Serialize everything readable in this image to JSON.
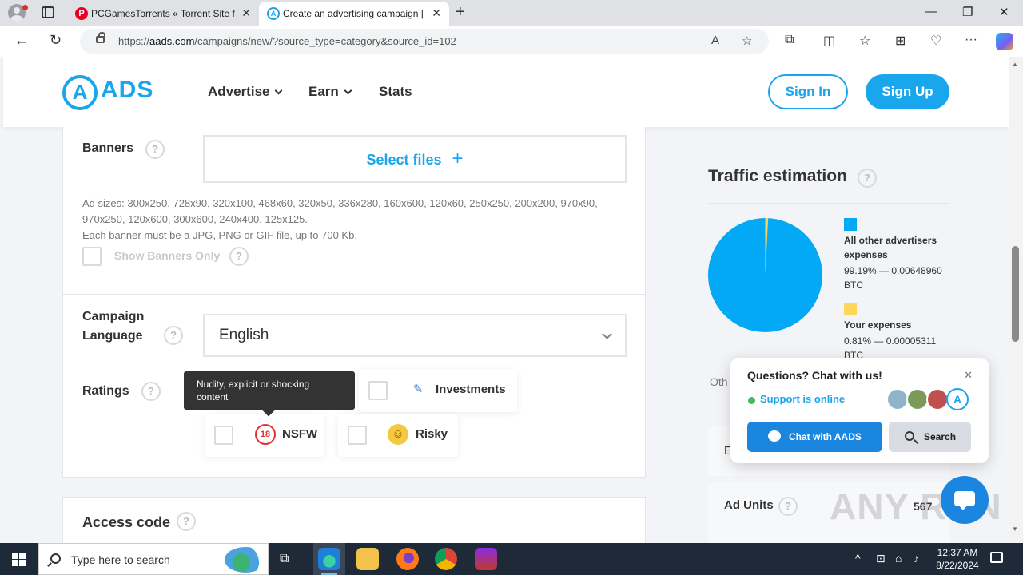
{
  "browser": {
    "tabs": [
      {
        "title": "PCGamesTorrents « Torrent Site f",
        "favicon": "pinterest-icon"
      },
      {
        "title": "Create an advertising campaign |",
        "favicon": "aads-icon"
      }
    ],
    "url_prefix": "https://",
    "url_domain": "aads.com",
    "url_path": "/campaigns/new/?source_type=category&source_id=102"
  },
  "header": {
    "logo_letter": "A",
    "logo_text": "ADS",
    "nav": [
      "Advertise",
      "Earn",
      "Stats"
    ],
    "sign_in": "Sign In",
    "sign_up": "Sign Up"
  },
  "form": {
    "banners_label": "Banners",
    "select_files": "Select files",
    "ad_sizes": "Ad sizes: 300x250, 728x90, 320x100, 468x60, 320x50, 336x280, 160x600, 120x60, 250x250, 200x200, 970x90, 970x250, 120x600, 300x600, 240x400, 125x125.",
    "banner_rule": "Each banner must be a JPG, PNG or GIF file, up to 700 Kb.",
    "show_banners_only": "Show Banners Only",
    "language_label_1": "Campaign",
    "language_label_2": "Language",
    "language_value": "English",
    "ratings_label": "Ratings",
    "ratings": [
      {
        "label": "Investments",
        "icon": "investments-icon"
      },
      {
        "label": "NSFW",
        "icon": "18-plus-icon"
      },
      {
        "label": "Risky",
        "icon": "thinking-face-icon"
      }
    ],
    "tooltip": "Nudity, explicit or shocking content",
    "access_code_label": "Access code",
    "help_glyph": "?"
  },
  "traffic": {
    "title": "Traffic estimation",
    "legend": [
      {
        "title": "All other advertisers expenses",
        "value": "99.19% — 0.00648960 BTC",
        "color": "#03a9f4"
      },
      {
        "title": "Your expenses",
        "value": "0.81% — 0.00005311 BTC",
        "color": "#fdd75b"
      }
    ],
    "other_cut": "Oth",
    "row_cut": "E",
    "ad_units_label": "Ad Units",
    "ad_units_value": "567"
  },
  "chat": {
    "question": "Questions? Chat with us!",
    "status": "Support is online",
    "chat_button": "Chat with AADS",
    "search_button": "Search",
    "avatar_letter": "A"
  },
  "watermark": "ANY RUN",
  "taskbar": {
    "search_placeholder": "Type here to search",
    "time": "12:37 AM",
    "date": "8/22/2024"
  }
}
